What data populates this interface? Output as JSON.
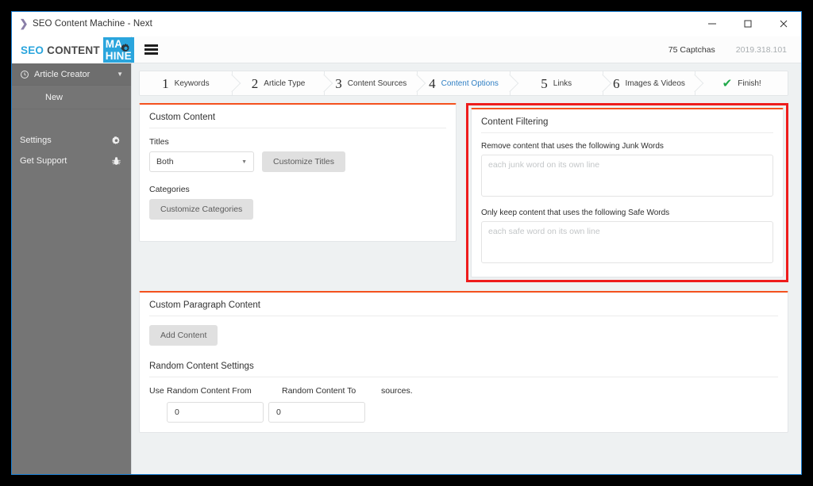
{
  "window": {
    "title": "SEO Content Machine - Next",
    "app_icon": "chevron-right-icon",
    "minimize_label": "–",
    "maximize_label": "□",
    "close_label": "✕"
  },
  "brand": {
    "seo": "SEO",
    "content": "CONTENT",
    "machine": "MA      HINE",
    "gear_icon": "gear-icon",
    "seo_color": "#2aa5dd",
    "badge_color": "#2aa5dd"
  },
  "sidebar": {
    "section": {
      "icon": "clock-icon",
      "label": "Article Creator",
      "caret": "▼"
    },
    "sub_items": [
      {
        "label": "New"
      }
    ],
    "links": [
      {
        "label": "Settings",
        "icon": "gear-icon"
      },
      {
        "label": "Get Support",
        "icon": "bug-icon"
      }
    ]
  },
  "topbar": {
    "menu_icon": "hamburger-menu-icon",
    "captchas": "75 Captchas",
    "version": "2019.318.101"
  },
  "steps": [
    {
      "num": "1",
      "label": "Keywords",
      "active": false
    },
    {
      "num": "2",
      "label": "Article Type",
      "active": false
    },
    {
      "num": "3",
      "label": "Content Sources",
      "active": false
    },
    {
      "num": "4",
      "label": "Content Options",
      "active": true
    },
    {
      "num": "5",
      "label": "Links",
      "active": false
    },
    {
      "num": "6",
      "label": "Images & Videos",
      "active": false
    },
    {
      "num": "✔",
      "label": "Finish!",
      "active": false,
      "is_check": true
    }
  ],
  "custom_content": {
    "title": "Custom Content",
    "titles_label": "Titles",
    "titles_select_value": "Both",
    "customize_titles_button": "Customize Titles",
    "categories_label": "Categories",
    "customize_categories_button": "Customize Categories"
  },
  "content_filtering": {
    "title": "Content Filtering",
    "junk_label": "Remove content that uses the following Junk Words",
    "junk_placeholder": "each junk word on its own line",
    "junk_value": "",
    "safe_label": "Only keep content that uses the following Safe Words",
    "safe_placeholder": "each safe word on its own line",
    "safe_value": "",
    "highlight_color": "#ee1c1c"
  },
  "custom_paragraph": {
    "title": "Custom Paragraph Content",
    "add_content_button": "Add Content",
    "random_title": "Random Content Settings",
    "use_label": "Use",
    "from_label": "Random Content From",
    "to_label": "Random Content To",
    "suffix_label": "sources.",
    "from_value": "0",
    "to_value": "0"
  },
  "theme": {
    "panel_accent": "#f4511e",
    "active_step": "#2f7fc4",
    "sidebar_bg": "#757575",
    "content_bg": "#eef1f2"
  }
}
